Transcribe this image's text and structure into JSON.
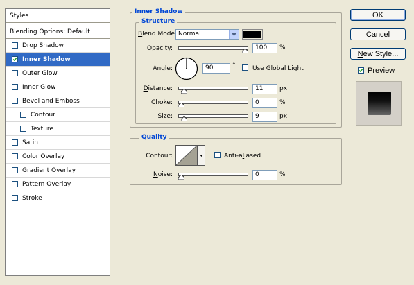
{
  "styles_panel": {
    "header": "Styles",
    "blending_options": "Blending Options: Default",
    "items": [
      {
        "label": "Drop Shadow",
        "checked": false,
        "indent": false,
        "selected": false
      },
      {
        "label": "Inner Shadow",
        "checked": true,
        "indent": false,
        "selected": true
      },
      {
        "label": "Outer Glow",
        "checked": false,
        "indent": false,
        "selected": false
      },
      {
        "label": "Inner Glow",
        "checked": false,
        "indent": false,
        "selected": false
      },
      {
        "label": "Bevel and Emboss",
        "checked": false,
        "indent": false,
        "selected": false
      },
      {
        "label": "Contour",
        "checked": false,
        "indent": true,
        "selected": false
      },
      {
        "label": "Texture",
        "checked": false,
        "indent": true,
        "selected": false
      },
      {
        "label": "Satin",
        "checked": false,
        "indent": false,
        "selected": false
      },
      {
        "label": "Color Overlay",
        "checked": false,
        "indent": false,
        "selected": false
      },
      {
        "label": "Gradient Overlay",
        "checked": false,
        "indent": false,
        "selected": false
      },
      {
        "label": "Pattern Overlay",
        "checked": false,
        "indent": false,
        "selected": false
      },
      {
        "label": "Stroke",
        "checked": false,
        "indent": false,
        "selected": false
      }
    ]
  },
  "inner_shadow": {
    "title": "Inner Shadow",
    "structure": {
      "title": "Structure",
      "blend_mode_label": "Blend Mode:",
      "blend_mode_value": "Normal",
      "shadow_color": "#000000",
      "opacity_label": "Opacity:",
      "opacity_value": "100",
      "opacity_unit": "%",
      "opacity_level": 1.0,
      "angle_label": "Angle:",
      "angle_value": "90",
      "angle_unit": "°",
      "use_global_light_label": "Use Global Light",
      "use_global_light_checked": false,
      "distance_label": "Distance:",
      "distance_value": "11",
      "distance_unit": "px",
      "distance_level": 0.04,
      "choke_label": "Choke:",
      "choke_value": "0",
      "choke_unit": "%",
      "choke_level": 0.0,
      "size_label": "Size:",
      "size_value": "9",
      "size_unit": "px",
      "size_level": 0.04
    },
    "quality": {
      "title": "Quality",
      "contour_label": "Contour:",
      "anti_aliased_label": "Anti-aliased",
      "anti_aliased_checked": false,
      "noise_label": "Noise:",
      "noise_value": "0",
      "noise_unit": "%",
      "noise_level": 0.0
    }
  },
  "buttons": {
    "ok": "OK",
    "cancel": "Cancel",
    "new_style": "New Style..."
  },
  "preview": {
    "label": "Preview",
    "checked": true
  }
}
